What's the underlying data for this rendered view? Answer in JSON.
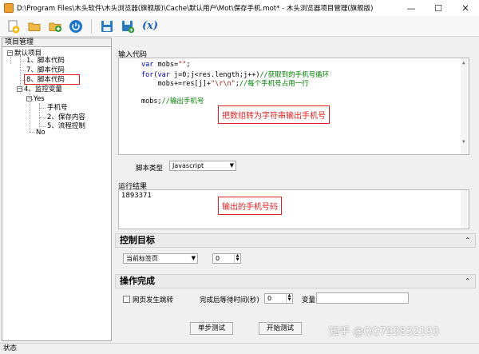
{
  "window": {
    "title": "D:\\Program Files\\木头软件\\木头浏览器(旗舰版)\\Cache\\默认用户\\Mot\\保存手机.mot* - 木头浏览器项目管理(旗舰版)",
    "minimize": "—",
    "maximize": "☐",
    "close": "✕"
  },
  "toolbar": {
    "icons": [
      "new-project-icon",
      "open-folder-icon",
      "add-item-icon",
      "power-icon",
      "save-icon",
      "save-as-icon",
      "variable-icon"
    ],
    "variable_label": "(x)"
  },
  "project_panel": {
    "title": "项目管理",
    "tree": {
      "root": "默认项目",
      "items": [
        "1、脚本代码",
        "7、脚本代码",
        "8、脚本代码",
        "4、监控变量"
      ],
      "yes": "Yes",
      "yes_children": [
        "手机号",
        "2、保存内容",
        "5、流程控制"
      ],
      "no": "No"
    }
  },
  "code_section": {
    "label": "输入代码",
    "lines": [
      {
        "parts": [
          {
            "t": "var ",
            "c": "kw"
          },
          {
            "t": "mobs=",
            "c": ""
          },
          {
            "t": "\"\"",
            "c": "st"
          },
          {
            "t": ";",
            "c": ""
          }
        ]
      },
      {
        "parts": [
          {
            "t": "for",
            "c": "kw"
          },
          {
            "t": "(",
            "c": ""
          },
          {
            "t": "var ",
            "c": "kw"
          },
          {
            "t": "j=0;j<res.length;j++)",
            "c": ""
          },
          {
            "t": "//获取到的手机号循环",
            "c": "cm"
          }
        ]
      },
      {
        "parts": [
          {
            "t": "    mobs+=res[j]+",
            "c": ""
          },
          {
            "t": "\"\\r\\n\"",
            "c": "st"
          },
          {
            "t": ";",
            "c": ""
          },
          {
            "t": "//每个手机号占用一行",
            "c": "cm"
          }
        ]
      },
      {
        "parts": [
          {
            "t": "",
            "c": ""
          }
        ]
      },
      {
        "parts": [
          {
            "t": "mobs;",
            "c": ""
          },
          {
            "t": "//输出手机号",
            "c": "cm"
          }
        ]
      }
    ],
    "callout": "把数组转为字符串输出手机号"
  },
  "script_type": {
    "label": "脚本类型",
    "value": "Javascript"
  },
  "result_section": {
    "label": "运行结果",
    "value": "1893371",
    "callout": "输出的手机号码"
  },
  "control_target": {
    "title": "控制目标",
    "chevron": "⌃",
    "tab_select": "当前标签页",
    "index_value": "0"
  },
  "operation_complete": {
    "title": "操作完成",
    "chevron": "⌃",
    "jump_label": "网页发生跳转",
    "wait_label": "完成后等待时间(秒)",
    "wait_value": "0",
    "variable_label": "变量"
  },
  "buttons": {
    "step_test": "单步测试",
    "start_test": "开始测试"
  },
  "status": {
    "text": "状态"
  },
  "watermark": "知乎 @QQ792832193"
}
